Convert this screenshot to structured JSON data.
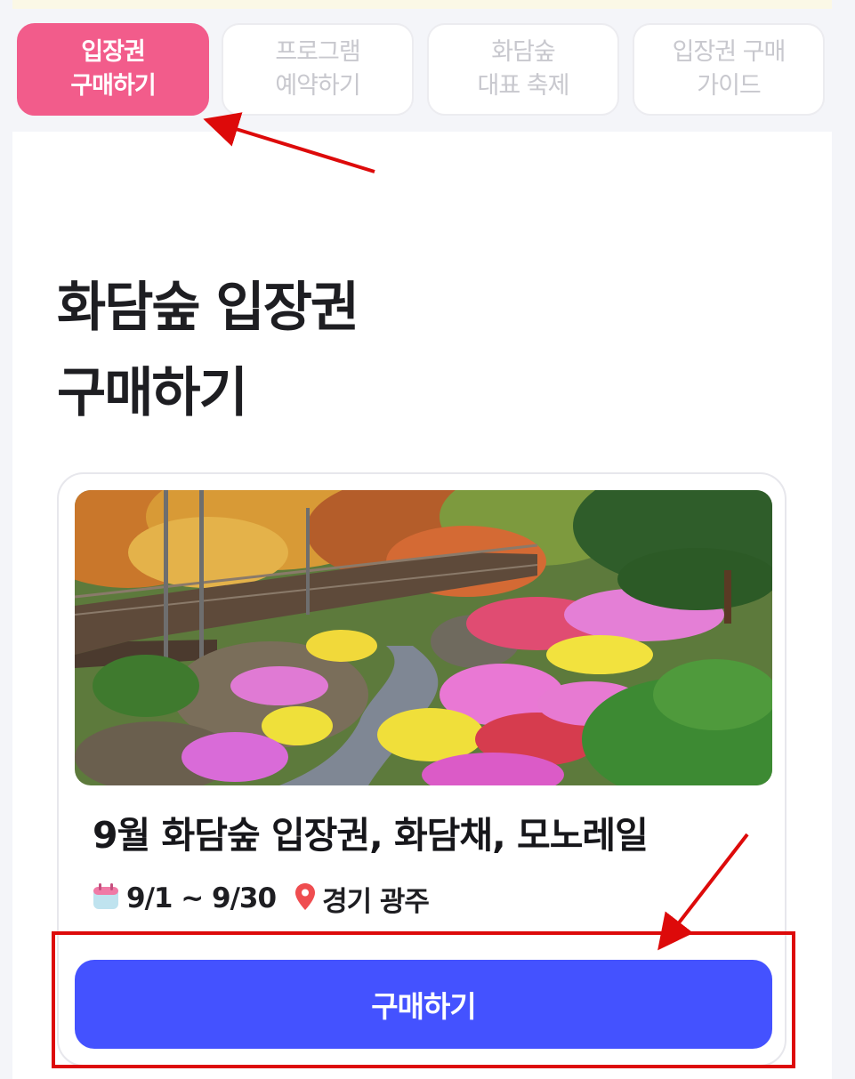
{
  "tabs": [
    {
      "line1": "입장권",
      "line2": "구매하기",
      "active": true
    },
    {
      "line1": "프로그램",
      "line2": "예약하기",
      "active": false
    },
    {
      "line1": "화담숲",
      "line2": "대표 축제",
      "active": false
    },
    {
      "line1": "입장권 구매",
      "line2": "가이드",
      "active": false
    }
  ],
  "page_title": {
    "line1": "화담숲 입장권",
    "line2": "구매하기"
  },
  "card": {
    "title": "9월 화담숲 입장권, 화담채, 모노레일",
    "date_icon": "calendar-icon",
    "date": "9/1 ~ 9/30",
    "location_icon": "location-pin-icon",
    "location": "경기 광주",
    "photo": "garden-flowers-walkway-photo",
    "button_label": "구매하기"
  },
  "colors": {
    "active_tab": "#f25c8b",
    "button": "#4452ff",
    "annotation": "#dd0a0a"
  }
}
